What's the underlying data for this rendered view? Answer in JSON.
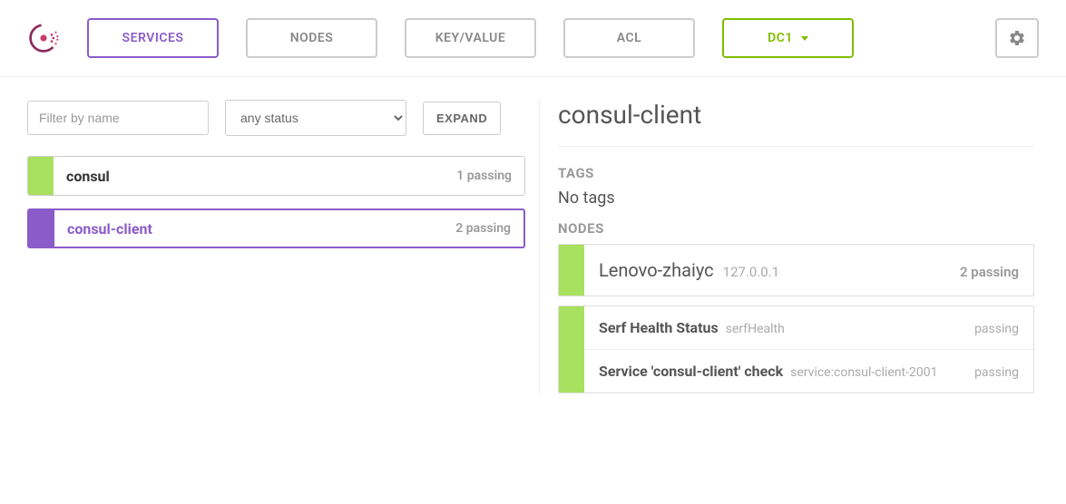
{
  "nav": {
    "services": "SERVICES",
    "nodes": "NODES",
    "keyvalue": "KEY/VALUE",
    "acl": "ACL",
    "dc": "DC1"
  },
  "filter": {
    "placeholder": "Filter by name",
    "status_option": "any status",
    "expand": "EXPAND"
  },
  "services": [
    {
      "name": "consul",
      "status": "1 passing",
      "selected": false
    },
    {
      "name": "consul-client",
      "status": "2 passing",
      "selected": true
    }
  ],
  "detail": {
    "title": "consul-client",
    "tags_label": "TAGS",
    "tags_value": "No tags",
    "nodes_label": "NODES",
    "node": {
      "name": "Lenovo-zhaiyc",
      "addr": "127.0.0.1",
      "status": "2 passing"
    },
    "checks": [
      {
        "title": "Serf Health Status",
        "id": "serfHealth",
        "status": "passing"
      },
      {
        "title": "Service 'consul-client' check",
        "id": "service:consul-client-2001",
        "status": "passing"
      }
    ]
  }
}
